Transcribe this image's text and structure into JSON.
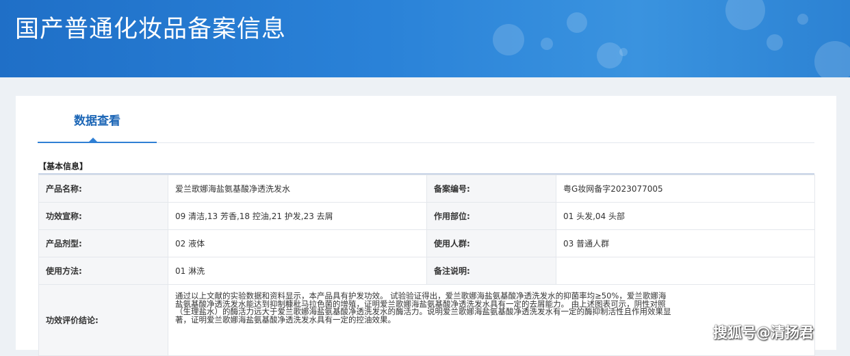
{
  "banner": {
    "title": "国产普通化妆品备案信息"
  },
  "tabs": [
    {
      "label": "数据查看",
      "active": true
    }
  ],
  "section": {
    "title": "【基本信息】"
  },
  "info_rows": [
    {
      "label_left": "产品名称:",
      "value_left": "爱兰歌娜海盐氨基酸净透洗发水",
      "label_right": "备案编号:",
      "value_right": "粤G妆网备字2023077005"
    },
    {
      "label_left": "功效宣称:",
      "value_left": "09 清洁,13 芳香,18 控油,21 护发,23 去屑",
      "label_right": "作用部位:",
      "value_right": "01 头发,04 头部"
    },
    {
      "label_left": "产品剂型:",
      "value_left": "02 液体",
      "label_right": "使用人群:",
      "value_right": "03 普通人群"
    },
    {
      "label_left": "使用方法:",
      "value_left": "01 淋洗",
      "label_right": "备注说明:",
      "value_right": ""
    }
  ],
  "evaluation": {
    "label": "功效评价结论:",
    "text": "通过以上文献的实验数据和资料显示，本产品具有护发功效。 试验验证得出，爱兰歌娜海盐氨基酸净透洗发水的抑菌率均≥50%，爱兰歌娜海盐氨基酸净透洗发水能达到抑制糠秕马拉色菌的增殖，证明爱兰歌娜海盐氨基酸净透洗发水具有一定的去屑能力。 由上述图表可示，阴性对照（生理盐水）的酶活力远大于爱兰歌娜海盐氨基酸净透洗发水的酶活力。说明爱兰歌娜海盐氨基酸净透洗发水有一定的酶抑制活性且作用效果显著，证明爱兰歌娜海盐氨基酸净透洗发水具有一定的控油效果。"
  },
  "watermark": "搜狐号@清扬君",
  "colors": {
    "banner": "#2a82d8",
    "accent": "#1c66b6",
    "label_bg": "#f5f6f8",
    "page_bg": "#edf1f5"
  }
}
